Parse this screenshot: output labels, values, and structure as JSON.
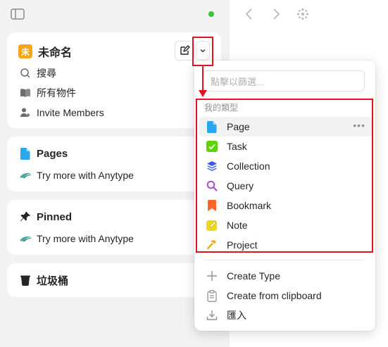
{
  "space": {
    "avatar_letter": "未",
    "name": "未命名"
  },
  "nav": {
    "search": "搜尋",
    "all_objects": "所有物件",
    "invite": "Invite Members"
  },
  "widgets": {
    "pages": {
      "title": "Pages",
      "subtitle": "Try more with Anytype"
    },
    "pinned": {
      "title": "Pinned",
      "subtitle": "Try more with Anytype"
    },
    "bin": {
      "title": "垃圾桶"
    }
  },
  "menu": {
    "search_placeholder": "點擊以篩選...",
    "section_label": "我的類型",
    "types": [
      {
        "label": "Page",
        "icon": "page-icon"
      },
      {
        "label": "Task",
        "icon": "task-checkbox-icon"
      },
      {
        "label": "Collection",
        "icon": "collection-layers-icon"
      },
      {
        "label": "Query",
        "icon": "query-search-icon"
      },
      {
        "label": "Bookmark",
        "icon": "bookmark-icon"
      },
      {
        "label": "Note",
        "icon": "note-pencil-icon"
      },
      {
        "label": "Project",
        "icon": "project-hammer-icon"
      }
    ],
    "more_dots": "•••",
    "actions": {
      "create_type": "Create Type",
      "create_from_clipboard": "Create from clipboard",
      "import": "匯入"
    }
  },
  "colors": {
    "accent_red": "#e0141e",
    "sync_green": "#3cc13b",
    "avatar_orange": "#f6a41c",
    "page_blue": "#2aa7ee",
    "task_green": "#5dd400",
    "collection_blue": "#3e58eb",
    "query_purple": "#ab50cc",
    "bookmark_orange": "#ff6626",
    "note_yellow": "#ecd91b",
    "project_orange": "#f6a41c"
  }
}
